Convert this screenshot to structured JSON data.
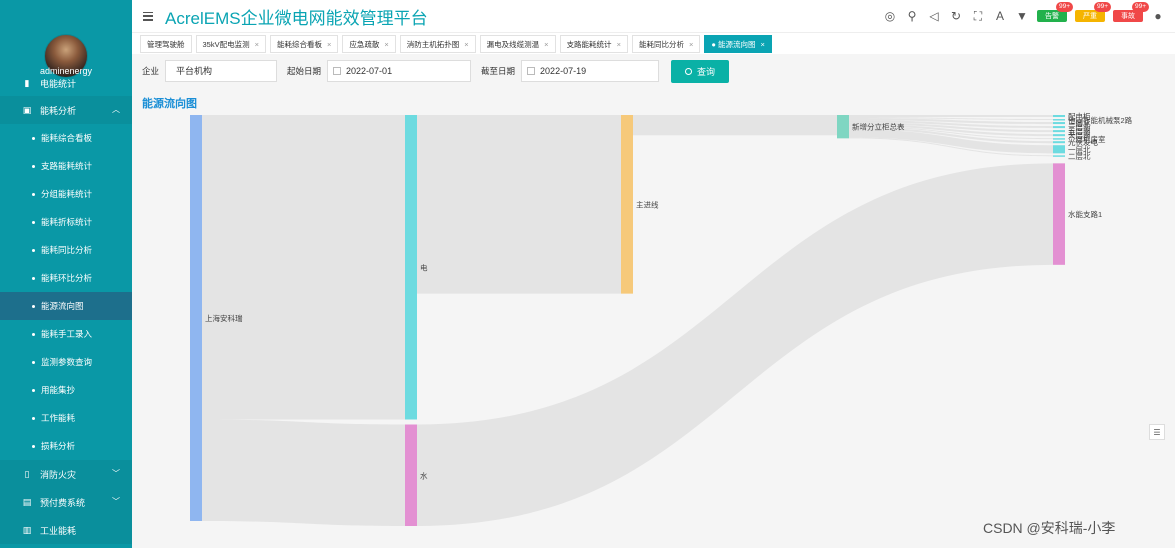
{
  "app": {
    "title": "AcrelEMS企业微电网能效管理平台",
    "username": "adminenergy"
  },
  "header_alarms": [
    {
      "label": "告警",
      "count": "99+",
      "color": "#22b14c"
    },
    {
      "label": "严重",
      "count": "99+",
      "color": "#f5b400"
    },
    {
      "label": "事故",
      "count": "99+",
      "color": "#f04848"
    }
  ],
  "sidebar": {
    "partial_top": {
      "label": "电能统计",
      "icon": "bar-chart-icon"
    },
    "group": {
      "label": "能耗分析",
      "icon": "image-icon"
    },
    "items": [
      {
        "label": "能耗综合看板"
      },
      {
        "label": "支路能耗统计"
      },
      {
        "label": "分组能耗统计"
      },
      {
        "label": "能耗折标统计"
      },
      {
        "label": "能耗同比分析"
      },
      {
        "label": "能耗环比分析"
      },
      {
        "label": "能源流向图",
        "active": true
      },
      {
        "label": "能耗手工录入"
      },
      {
        "label": "监测参数查询"
      },
      {
        "label": "用能集抄"
      },
      {
        "label": "工作能耗"
      },
      {
        "label": "损耗分析"
      }
    ],
    "lower_groups": [
      {
        "label": "消防火灾",
        "icon": "fire-extinguisher-icon"
      },
      {
        "label": "预付费系统",
        "icon": "prepay-icon"
      },
      {
        "label": "工业能耗",
        "icon": "factory-icon"
      }
    ]
  },
  "tabs": [
    {
      "label": "管理驾驶舱",
      "closable": false
    },
    {
      "label": "35kV配电监测",
      "closable": true
    },
    {
      "label": "能耗综合看板",
      "closable": true
    },
    {
      "label": "应急疏散",
      "closable": true
    },
    {
      "label": "消防主机拓扑图",
      "closable": true
    },
    {
      "label": "漏电及线缆测温",
      "closable": true
    },
    {
      "label": "支路能耗统计",
      "closable": true
    },
    {
      "label": "能耗同比分析",
      "closable": true
    },
    {
      "label": "能源流向图",
      "closable": true,
      "active": true
    }
  ],
  "filter": {
    "company_label": "企业",
    "company_value": "平台机构",
    "start_label": "起始日期",
    "start_value": "2022-07-01",
    "end_label": "截至日期",
    "end_value": "2022-07-19",
    "query_label": "查询"
  },
  "section_title": "能源流向图",
  "chart_data": {
    "type": "sankey",
    "nodes": [
      {
        "name": "上海安科瑞",
        "color": "#8fb6f0"
      },
      {
        "name": "电",
        "color": "#6ddbe0"
      },
      {
        "name": "水",
        "color": "#e390d2"
      },
      {
        "name": "主进线",
        "color": "#f6c97a"
      },
      {
        "name": "新增分立柜总表",
        "color": "#7fd6c2"
      },
      {
        "name": "配电柜",
        "color": "#6ddbe0"
      },
      {
        "name": "他固智能机械泵2路",
        "color": "#6ddbe0"
      },
      {
        "name": "三层北",
        "color": "#6ddbe0"
      },
      {
        "name": "三层南",
        "color": "#6ddbe0"
      },
      {
        "name": "五层南",
        "color": "#6ddbe0"
      },
      {
        "name": "天层南",
        "color": "#6ddbe0"
      },
      {
        "name": "二层机房室",
        "color": "#6ddbe0"
      },
      {
        "name": "光伏发电",
        "color": "#6ddbe0"
      },
      {
        "name": "一层北",
        "color": "#6ddbe0"
      },
      {
        "name": "二层北",
        "color": "#6ddbe0"
      },
      {
        "name": "水能支路1",
        "color": "#e390d2"
      }
    ],
    "links": [
      {
        "source": "上海安科瑞",
        "target": "电",
        "value": 300
      },
      {
        "source": "上海安科瑞",
        "target": "水",
        "value": 100
      },
      {
        "source": "电",
        "target": "主进线",
        "value": 176
      },
      {
        "source": "主进线",
        "target": "新增分立柜总表",
        "value": 20
      },
      {
        "source": "新增分立柜总表",
        "target": "配电柜",
        "value": 2
      },
      {
        "source": "新增分立柜总表",
        "target": "他固智能机械泵2路",
        "value": 1
      },
      {
        "source": "新增分立柜总表",
        "target": "三层北",
        "value": 2
      },
      {
        "source": "新增分立柜总表",
        "target": "三层南",
        "value": 2
      },
      {
        "source": "新增分立柜总表",
        "target": "五层南",
        "value": 2
      },
      {
        "source": "新增分立柜总表",
        "target": "天层南",
        "value": 2
      },
      {
        "source": "新增分立柜总表",
        "target": "二层机房室",
        "value": 1
      },
      {
        "source": "新增分立柜总表",
        "target": "光伏发电",
        "value": 2
      },
      {
        "source": "新增分立柜总表",
        "target": "一层北",
        "value": 8
      },
      {
        "source": "新增分立柜总表",
        "target": "二层北",
        "value": 1
      },
      {
        "source": "水",
        "target": "水能支路1",
        "value": 100
      }
    ]
  },
  "watermark": "CSDN @安科瑞-小李"
}
